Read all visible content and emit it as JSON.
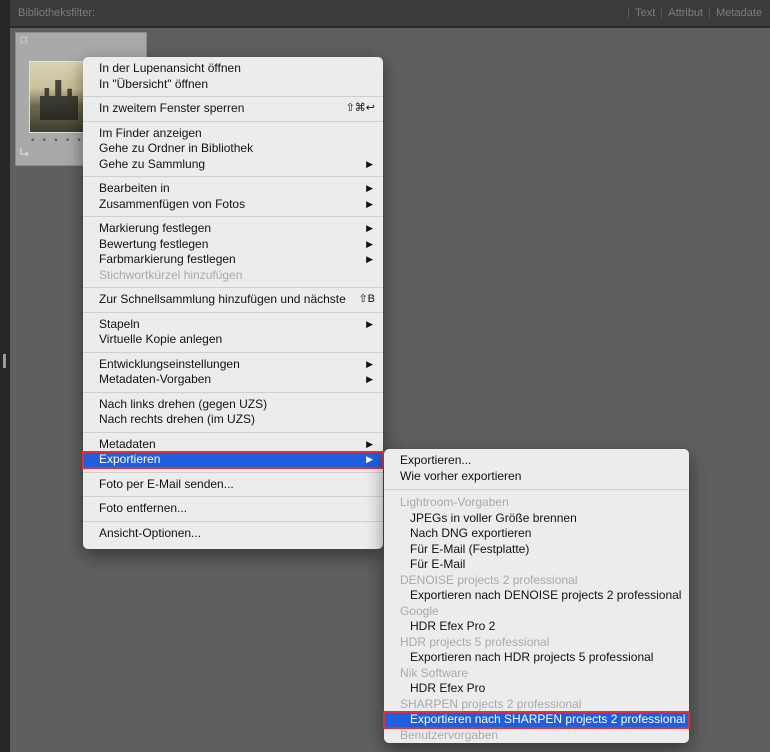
{
  "topbar": {
    "label": "Bibliotheksfilter:",
    "filters": [
      "Text",
      "Attribut",
      "Metadate"
    ]
  },
  "thumbnail": {
    "rating_dots": "• • • • •"
  },
  "context_menu": {
    "groups": [
      [
        {
          "label": "In der Lupenansicht öffnen"
        },
        {
          "label": "In \"Übersicht\" öffnen"
        }
      ],
      [
        {
          "label": "In zweitem Fenster sperren",
          "shortcut": "⇧⌘↩"
        }
      ],
      [
        {
          "label": "Im Finder anzeigen"
        },
        {
          "label": "Gehe zu Ordner in Bibliothek"
        },
        {
          "label": "Gehe zu Sammlung",
          "arrow": "▶"
        }
      ],
      [
        {
          "label": "Bearbeiten in",
          "arrow": "▶"
        },
        {
          "label": "Zusammenfügen von Fotos",
          "arrow": "▶"
        }
      ],
      [
        {
          "label": "Markierung festlegen",
          "arrow": "▶"
        },
        {
          "label": "Bewertung festlegen",
          "arrow": "▶"
        },
        {
          "label": "Farbmarkierung festlegen",
          "arrow": "▶"
        },
        {
          "label": "Stichwortkürzel hinzufügen",
          "disabled": true
        }
      ],
      [
        {
          "label": "Zur Schnellsammlung hinzufügen und nächste",
          "shortcut": "⇧B"
        }
      ],
      [
        {
          "label": "Stapeln",
          "arrow": "▶"
        },
        {
          "label": "Virtuelle Kopie anlegen"
        }
      ],
      [
        {
          "label": "Entwicklungseinstellungen",
          "arrow": "▶"
        },
        {
          "label": "Metadaten-Vorgaben",
          "arrow": "▶"
        }
      ],
      [
        {
          "label": "Nach links drehen (gegen UZS)"
        },
        {
          "label": "Nach rechts drehen (im UZS)"
        }
      ],
      [
        {
          "label": "Metadaten",
          "arrow": "▶"
        },
        {
          "label": "Exportieren",
          "arrow": "▶",
          "highlight": true
        }
      ],
      [
        {
          "label": "Foto per E-Mail senden..."
        }
      ],
      [
        {
          "label": "Foto entfernen..."
        }
      ],
      [
        {
          "label": "Ansicht-Optionen..."
        }
      ]
    ]
  },
  "export_submenu": {
    "groups": [
      [
        {
          "label": "Exportieren..."
        },
        {
          "label": "Wie vorher exportieren"
        }
      ],
      [
        {
          "label": "Lightroom-Vorgaben",
          "header": true
        },
        {
          "label": "JPEGs in voller Größe brennen",
          "indent": true
        },
        {
          "label": "Nach DNG exportieren",
          "indent": true
        },
        {
          "label": "Für E-Mail (Festplatte)",
          "indent": true
        },
        {
          "label": "Für E-Mail",
          "indent": true
        },
        {
          "label": "DENOISE projects 2 professional",
          "header": true
        },
        {
          "label": "Exportieren nach DENOISE projects 2 professional",
          "indent": true
        },
        {
          "label": "Google",
          "header": true
        },
        {
          "label": "HDR Efex Pro 2",
          "indent": true
        },
        {
          "label": "HDR projects 5 professional",
          "header": true
        },
        {
          "label": "Exportieren nach HDR projects 5 professional",
          "indent": true
        },
        {
          "label": "Nik Software",
          "header": true
        },
        {
          "label": "HDR Efex Pro",
          "indent": true
        },
        {
          "label": "SHARPEN projects 2 professional",
          "header": true
        },
        {
          "label": "Exportieren nach SHARPEN projects 2 professional",
          "indent": true,
          "highlight": true
        },
        {
          "label": "Benutzervorgaben",
          "header": true
        }
      ]
    ]
  },
  "colors": {
    "highlight": "#1f5fde",
    "highlight_outline": "#e0303a",
    "menu_bg": "#ececec",
    "workspace_bg": "#5f5f5f"
  }
}
